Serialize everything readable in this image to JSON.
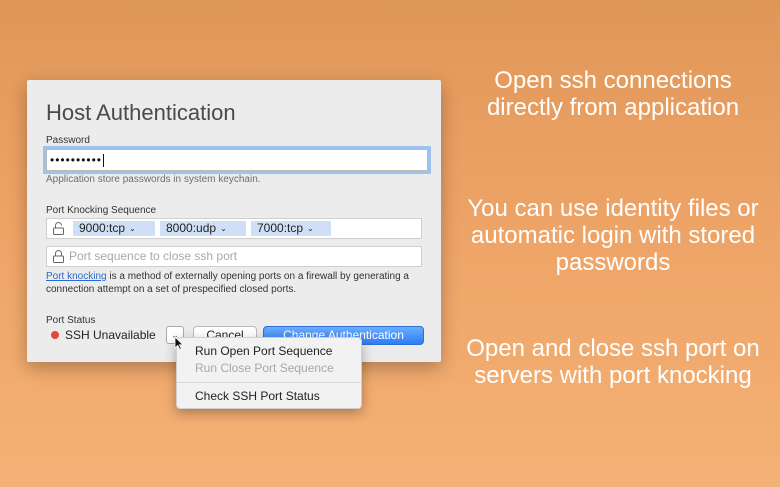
{
  "dialog": {
    "title": "Host Authentication",
    "password_label": "Password",
    "password_value": "••••••••••",
    "password_hint": "Application store passwords in system keychain.",
    "knock_label": "Port Knocking Sequence",
    "tokens": [
      "9000:tcp",
      "8000:udp",
      "7000:tcp"
    ],
    "close_placeholder": "Port sequence to close ssh port",
    "desc_link": "Port knocking",
    "desc_rest": " is a method of externally opening ports on a firewall by generating a connection attempt on a set of prespecified closed ports.",
    "status_label": "Port Status",
    "status_text": "SSH Unavailable",
    "cancel_label": "Cancel",
    "change_label": "Change Authentication"
  },
  "menu": {
    "items": [
      "Run Open Port Sequence",
      "Run Close Port Sequence",
      "Check SSH Port Status"
    ]
  },
  "captions": [
    "Open ssh connections directly from application",
    "You can use identity files or automatic login with stored passwords",
    "Open and close ssh port on servers with port knocking"
  ],
  "colors": {
    "accent": "#2f7bf5",
    "status_red": "#e5453c",
    "link": "#2a6ad1"
  }
}
